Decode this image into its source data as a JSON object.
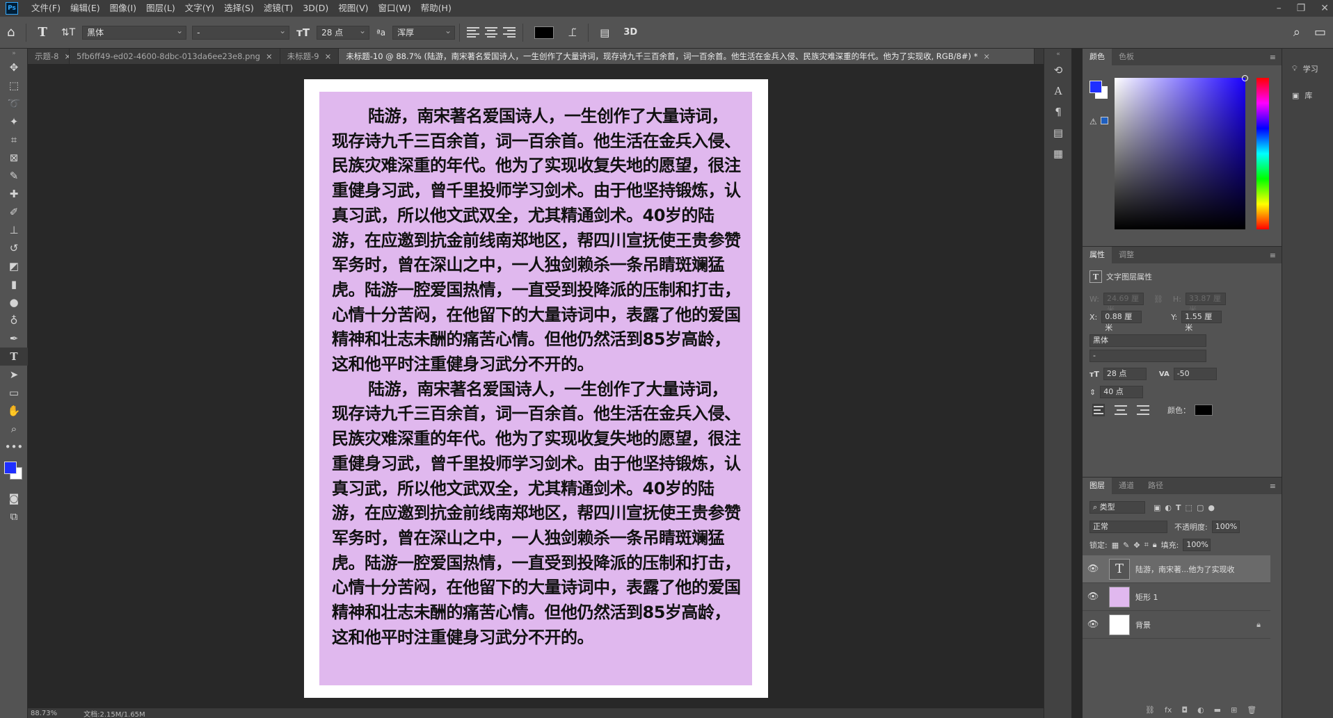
{
  "menu": [
    "文件(F)",
    "编辑(E)",
    "图像(I)",
    "图层(L)",
    "文字(Y)",
    "选择(S)",
    "滤镜(T)",
    "3D(D)",
    "视图(V)",
    "窗口(W)",
    "帮助(H)"
  ],
  "app_logo": "Ps",
  "options": {
    "font_family": "黑体",
    "font_style": "-",
    "font_size": "28 点",
    "aa_label": "ªa",
    "anti_alias": "浑厚",
    "threed_label": "3D",
    "text_color": "#000000"
  },
  "tabs": [
    {
      "label": "示题-8",
      "close": "×"
    },
    {
      "label": "5fb6ff49-ed02-4600-8dbc-013da6ee23e8.png",
      "close": "×"
    },
    {
      "label": "未标题-9",
      "close": "×"
    },
    {
      "label": "未标题-10 @ 88.7% (陆游，南宋著名爱国诗人，一生创作了大量诗词，现存诗九千三百余首，词一百余首。他生活在金兵入侵、民族灾难深重的年代。他为了实现收, RGB/8#) *",
      "close": "×"
    }
  ],
  "document": {
    "page_color": "#ffffff",
    "rect_color": "#e0b8ee",
    "paragraphs": [
      "陆游，南宋著名爱国诗人，一生创作了大量诗词，现存诗九千三百余首，词一百余首。他生活在金兵入侵、民族灾难深重的年代。他为了实现收复失地的愿望，很注重健身习武，曾千里投师学习剑术。由于他坚持锻炼，认真习武，所以他文武双全，尤其精通剑术。40岁的陆游，在应邀到抗金前线南郑地区，帮四川宣抚使王贵参赞军务时，曾在深山之中，一人独剑赖杀一条吊睛斑斓猛虎。陆游一腔爱国热情，一直受到投降派的压制和打击，心情十分苦闷，在他留下的大量诗词中，表露了他的爱国精神和壮志未酬的痛苦心情。但他仍然活到85岁高龄，这和他平时注重健身习武分不开的。",
      "陆游，南宋著名爱国诗人，一生创作了大量诗词，现存诗九千三百余首，词一百余首。他生活在金兵入侵、民族灾难深重的年代。他为了实现收复失地的愿望，很注重健身习武，曾千里投师学习剑术。由于他坚持锻炼，认真习武，所以他文武双全，尤其精通剑术。40岁的陆游，在应邀到抗金前线南郑地区，帮四川宣抚使王贵参赞军务时，曾在深山之中，一人独剑赖杀一条吊睛斑斓猛虎。陆游一腔爱国热情，一直受到投降派的压制和打击，心情十分苦闷，在他留下的大量诗词中，表露了他的爱国精神和壮志未酬的痛苦心情。但他仍然活到85岁高龄，这和他平时注重健身习武分不开的。"
    ]
  },
  "status": {
    "zoom": "88.73%",
    "doc": "文档:2.15M/1.65M"
  },
  "color_panel": {
    "tabs": [
      "颜色",
      "色板"
    ],
    "fg": "#1f2fff",
    "bg": "#ffffff"
  },
  "properties": {
    "tabs": [
      "属性",
      "调整"
    ],
    "title": "文字图层属性",
    "w_label": "W:",
    "w": "24.69 厘米",
    "link_label": "⛓",
    "h_label": "H:",
    "h": "33.87 厘米",
    "x_label": "X:",
    "x": "0.88 厘米",
    "y_label": "Y:",
    "y": "1.55 厘米",
    "font": "黑体",
    "style": "-",
    "size": "28 点",
    "tracking_label": "VA",
    "tracking": "-50",
    "leading": "40 点",
    "color_label": "颜色：",
    "color": "#000000"
  },
  "layers": {
    "tabs": [
      "图层",
      "通道",
      "路径"
    ],
    "filter": "类型",
    "blend": "正常",
    "opacity_label": "不透明度:",
    "opacity": "100%",
    "lock_label": "锁定:",
    "fill_label": "填充:",
    "fill": "100%",
    "items": [
      {
        "name": "陆游，南宋著...他为了实现收",
        "thumb": "T"
      },
      {
        "name": "矩形 1",
        "thumb": ""
      },
      {
        "name": "背景",
        "thumb": ""
      }
    ]
  },
  "side_tabs": [
    "学习",
    "库"
  ]
}
